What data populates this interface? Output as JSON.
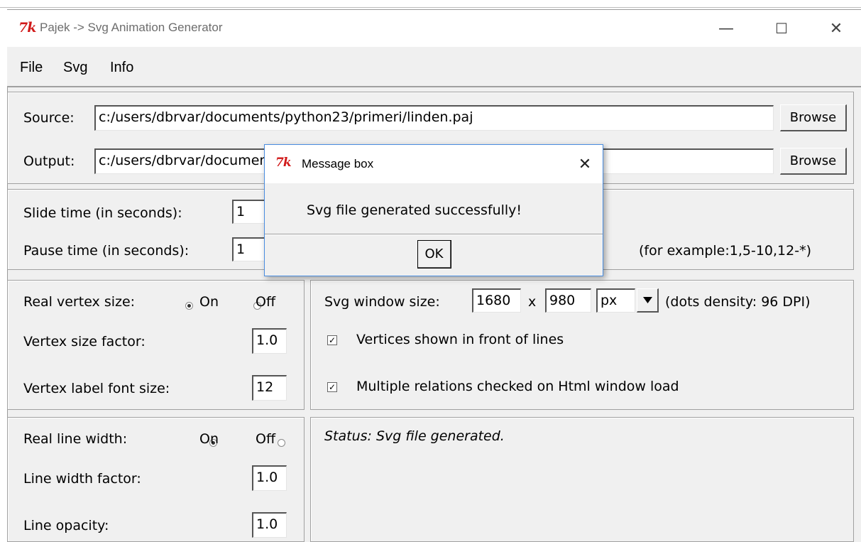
{
  "window": {
    "title": "Pajek -> Svg Animation Generator",
    "logo": "7k",
    "controls": {
      "minimize": "—",
      "maximize": "☐",
      "close": "✕"
    }
  },
  "menu": {
    "file": "File",
    "svg": "Svg",
    "info": "Info"
  },
  "paths": {
    "source_label": "Source:",
    "source_value": "c:/users/dbrvar/documents/python23/primeri/linden.paj",
    "output_label": "Output:",
    "output_value": "c:/users/dbrvar/documents/python23/primeri/linden.svg",
    "browse_label": "Browse"
  },
  "timing": {
    "slide_label": "Slide time (in seconds):",
    "slide_value": "1",
    "pause_label": "Pause time (in seconds):",
    "pause_value": "1",
    "example_hint": "(for example:1,5-10,12-*)"
  },
  "vertex": {
    "real_size_label": "Real vertex size:",
    "on_label": "On",
    "off_label": "Off",
    "real_size_selected": "On",
    "size_factor_label": "Vertex size factor:",
    "size_factor_value": "1.0",
    "font_size_label": "Vertex label font size:",
    "font_size_value": "12"
  },
  "svg_options": {
    "window_size_label": "Svg window size:",
    "width_value": "1680",
    "x_sep": "x",
    "height_value": "980",
    "unit_value": "px",
    "density_text": "(dots density: 96 DPI)",
    "vertices_front_label": "Vertices shown in front of lines",
    "vertices_front_checked": true,
    "multiple_relations_label": "Multiple relations checked on Html window load",
    "multiple_relations_checked": true
  },
  "line": {
    "real_width_label": "Real line width:",
    "on_label": "On",
    "off_label": "Off",
    "real_width_selected": "On",
    "width_factor_label": "Line width factor:",
    "width_factor_value": "1.0",
    "opacity_label": "Line opacity:",
    "opacity_value": "1.0"
  },
  "status": {
    "text": "Status: Svg file generated."
  },
  "dialog": {
    "title": "Message box",
    "message": "Svg file generated successfully!",
    "ok_label": "OK",
    "close_symbol": "✕"
  },
  "colors": {
    "tk_logo": "#d11919",
    "dialog_border": "#4a8de0",
    "window_bg": "#f0f0f0"
  }
}
